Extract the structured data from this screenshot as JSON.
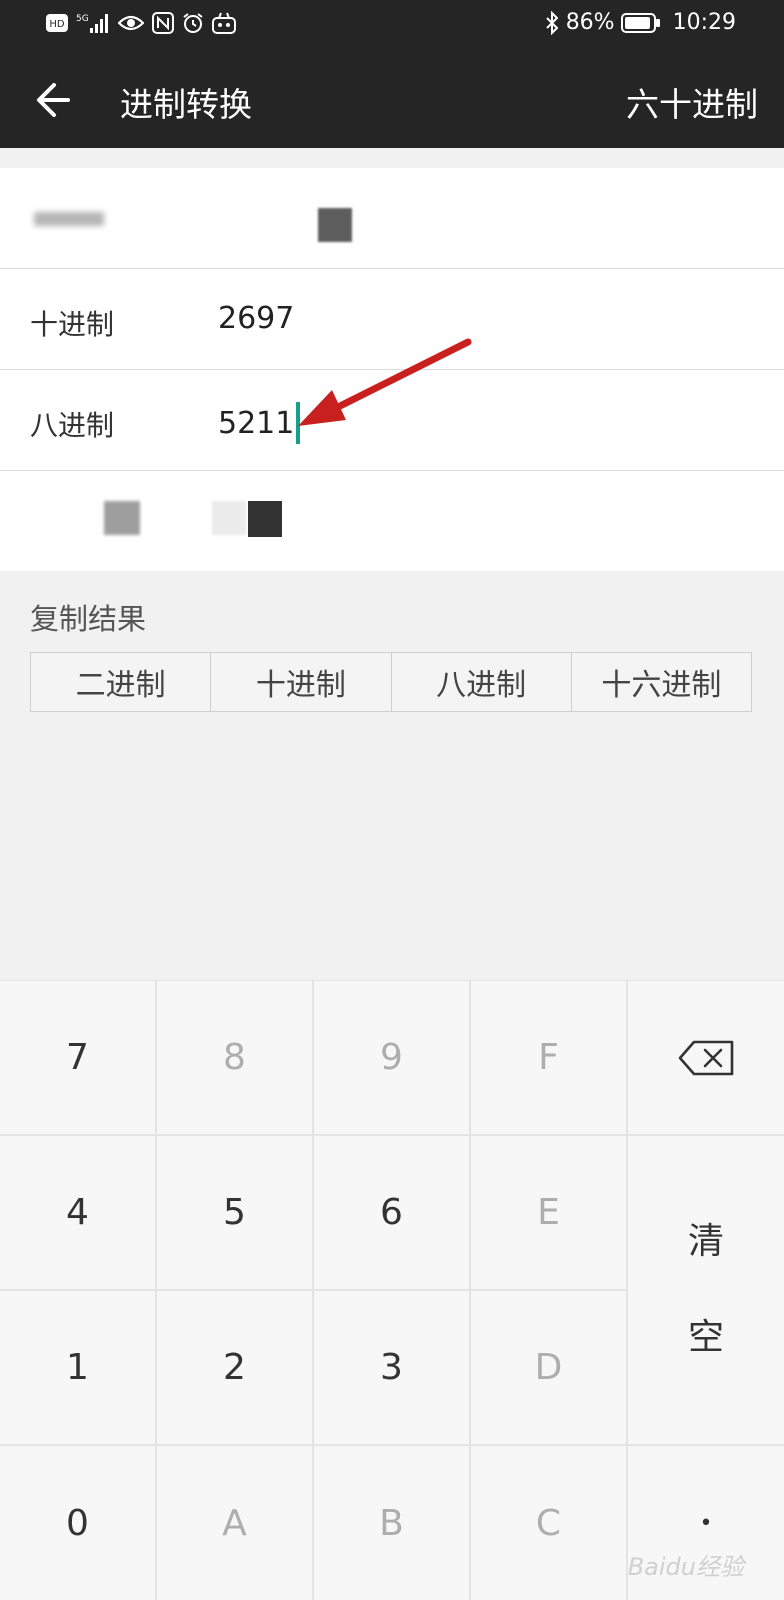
{
  "status": {
    "left_icons": [
      "hd-icon",
      "5g-signal-icon",
      "eye-icon",
      "nfc-icon",
      "alarm-icon",
      "app-icon"
    ],
    "bluetooth_icon": "bluetooth-icon",
    "battery": "86%",
    "time": "10:29"
  },
  "appbar": {
    "title": "进制转换",
    "mode": "六十进制"
  },
  "rows": {
    "decimal": {
      "label": "十进制",
      "value": "2697"
    },
    "octal": {
      "label": "八进制",
      "value": "5211"
    }
  },
  "copy": {
    "title": "复制结果",
    "buttons": [
      "二进制",
      "十进制",
      "八进制",
      "十六进制"
    ]
  },
  "keypad": {
    "k7": "7",
    "k8": "8",
    "k9": "9",
    "kF": "F",
    "k4": "4",
    "k5": "5",
    "k6": "6",
    "kE": "E",
    "k1": "1",
    "k2": "2",
    "k3": "3",
    "kD": "D",
    "k0": "0",
    "kA": "A",
    "kB": "B",
    "kC": "C",
    "clear_1": "清",
    "clear_2": "空",
    "dot": "•"
  },
  "colors": {
    "bar": "#252525",
    "caret": "#15a08a",
    "annotation_arrow": "#c8201e"
  },
  "watermark": "Baidu经验"
}
